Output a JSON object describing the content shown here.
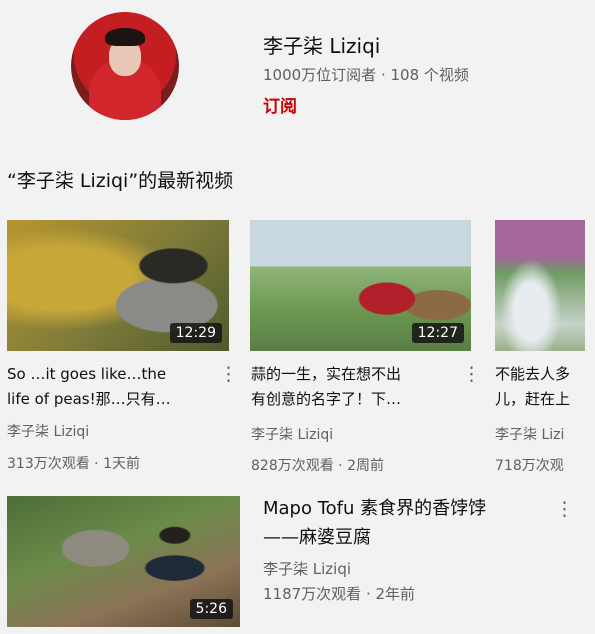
{
  "channel": {
    "name": "李子柒 Liziqi",
    "meta": "1000万位订阅者 · 108 个视频",
    "subscribe_label": "订阅"
  },
  "section": {
    "title": "“李子柒 Liziqi”的最新视频"
  },
  "videos": [
    {
      "title_line1": "So …it goes like…the",
      "title_line2": "life of peas!那…只有…",
      "channel": "李子柒 Liziqi",
      "stats": "313万次观看 · 1天前",
      "duration": "12:29"
    },
    {
      "title_line1": "蒜的一生，实在想不出",
      "title_line2": "有创意的名字了！下…",
      "channel": "李子柒 Liziqi",
      "stats": "828万次观看 · 2周前",
      "duration": "12:27"
    },
    {
      "title_line1": "不能去人多",
      "title_line2": "儿，赶在上",
      "channel": "李子柒 Lizi",
      "stats": "718万次观"
    },
    {
      "title_line1": "Mapo Tofu 素食界的香饽饽",
      "title_line2": "——麻婆豆腐",
      "channel": "李子柒 Liziqi",
      "stats": "1187万次观看 · 2年前",
      "duration": "5:26"
    }
  ],
  "icons": {
    "more": "more-vert-icon"
  }
}
